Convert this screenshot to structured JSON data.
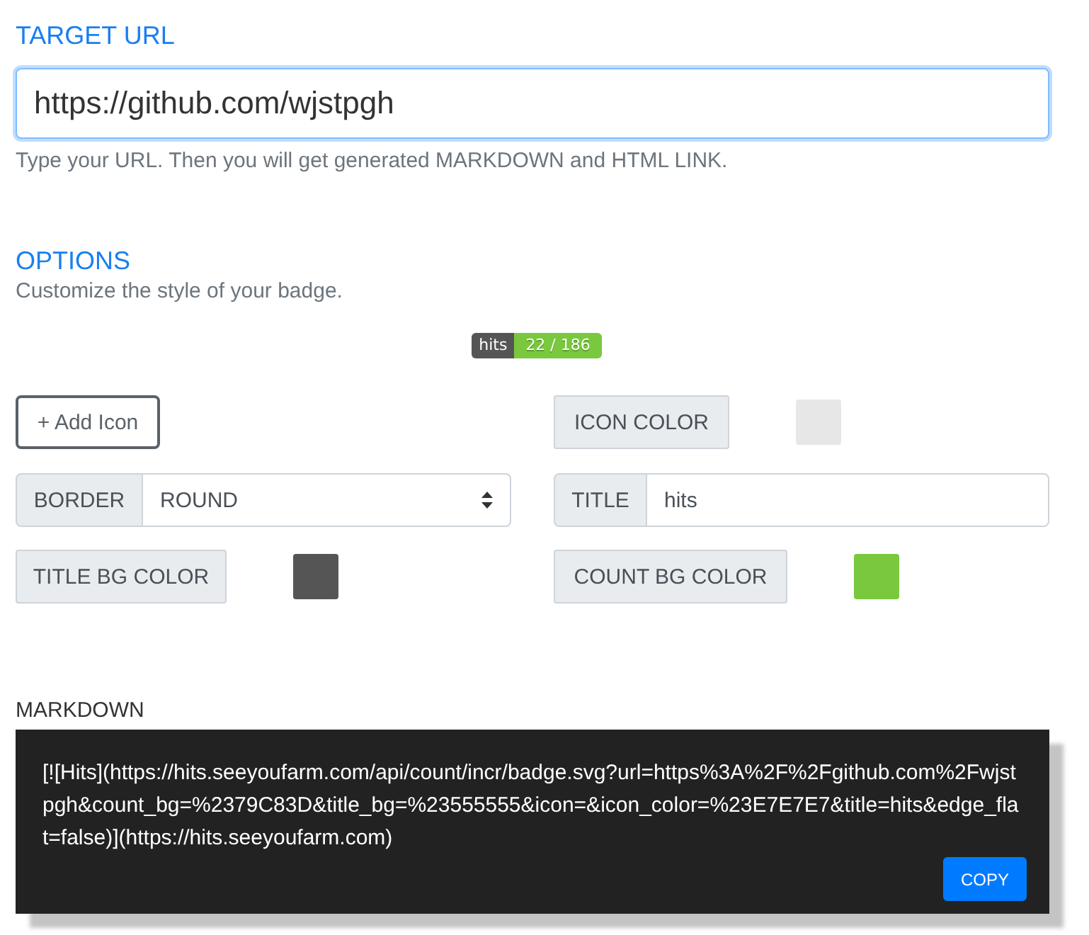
{
  "target_url": {
    "heading": "TARGET URL",
    "value": "https://github.com/wjstpgh",
    "focused": true,
    "help": "Type your URL. Then you will get generated MARKDOWN and HTML LINK."
  },
  "options": {
    "heading": "OPTIONS",
    "subtitle": "Customize the style of your badge.",
    "badge": {
      "title": "hits",
      "count": "22 / 186"
    },
    "add_icon_button": "+ Add Icon",
    "icon_color": {
      "label": "ICON COLOR",
      "color": "#e7e7e7"
    },
    "border": {
      "label": "BORDER",
      "value": "ROUND"
    },
    "title": {
      "label": "TITLE",
      "value": "hits"
    },
    "title_bg_color": {
      "label": "TITLE BG COLOR",
      "color": "#555555"
    },
    "count_bg_color": {
      "label": "COUNT BG COLOR",
      "color": "#79c83d"
    }
  },
  "markdown": {
    "label": "MARKDOWN",
    "code": "[![Hits](https://hits.seeyoufarm.com/api/count/incr/badge.svg?url=https%3A%2F%2Fgithub.com%2Fwjstpgh&count_bg=%2379C83D&title_bg=%23555555&icon=&icon_color=%23E7E7E7&title=hits&edge_flat=false)](https://hits.seeyoufarm.com)",
    "copy_button": "COPY"
  }
}
